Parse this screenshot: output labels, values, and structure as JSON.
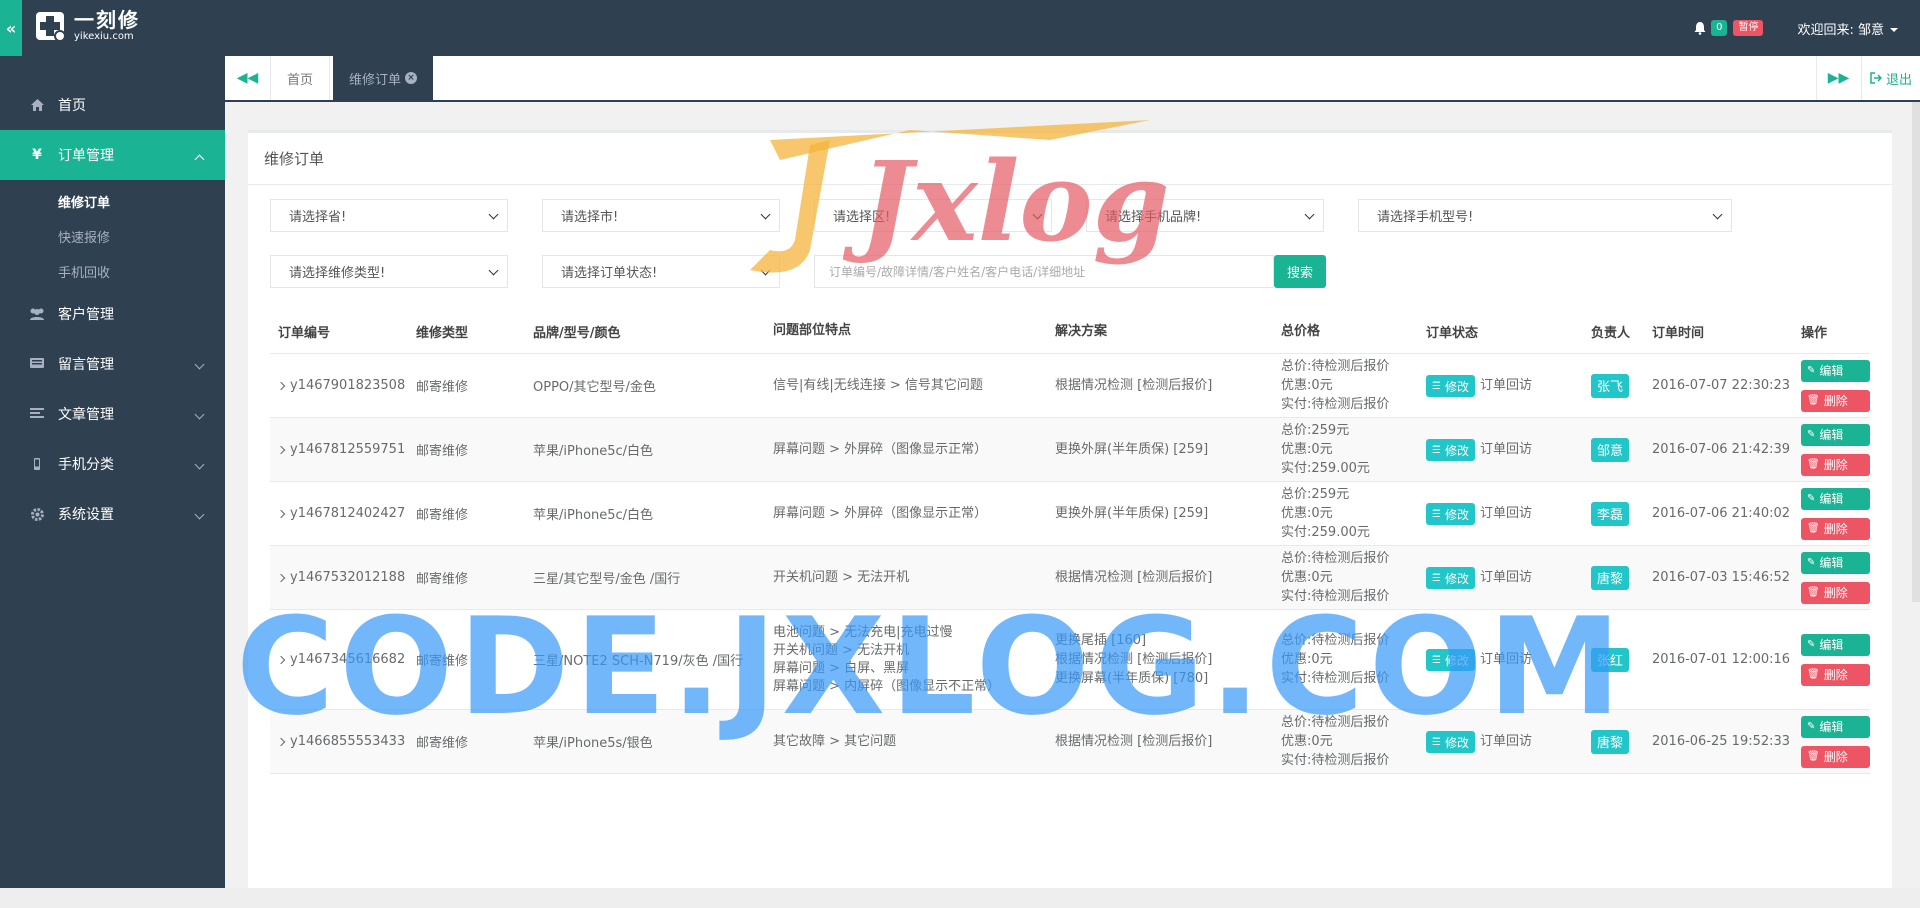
{
  "header": {
    "logo_cn": "一刻修",
    "logo_en": "yikexiu.com",
    "badge_count": "0",
    "badge_status": "暂停",
    "welcome": "欢迎回来: 邹意"
  },
  "sidebar": {
    "items": [
      {
        "label": "首页",
        "icon": "home-icon"
      },
      {
        "label": "订单管理",
        "icon": "yen-icon"
      },
      {
        "label": "客户管理",
        "icon": "users-icon"
      },
      {
        "label": "留言管理",
        "icon": "message-icon"
      },
      {
        "label": "文章管理",
        "icon": "list-icon"
      },
      {
        "label": "手机分类",
        "icon": "mobile-icon"
      },
      {
        "label": "系统设置",
        "icon": "gear-icon"
      }
    ],
    "sub_items": [
      "维修订单",
      "快速报修",
      "手机回收"
    ]
  },
  "tabs": {
    "home": "首页",
    "current": "维修订单",
    "logout": "退出"
  },
  "panel": {
    "title": "维修订单"
  },
  "filters": {
    "province": "请选择省!",
    "city": "请选择市!",
    "district": "请选择区!",
    "brand": "请选择手机品牌!",
    "model": "请选择手机型号!",
    "repair_type": "请选择维修类型!",
    "order_status": "请选择订单状态!",
    "search_placeholder": "订单编号/故障详情/客户姓名/客户电话/详细地址",
    "search_button": "搜索"
  },
  "table": {
    "headers": [
      "订单编号",
      "维修类型",
      "品牌/型号/颜色",
      "问题部位特点",
      "解决方案",
      "总价格",
      "订单状态",
      "负责人",
      "订单时间",
      "操作"
    ],
    "labels": {
      "modify": "修改",
      "visit": "订单回访",
      "edit": "编辑",
      "delete": "删除",
      "total": "总价:",
      "discount": "优惠:",
      "paid": "实付:"
    },
    "rows": [
      {
        "id": "y1467901823508",
        "type": "邮寄维修",
        "device": "OPPO/其它型号/金色",
        "issues": [
          "信号|有线|无线连接 > 信号其它问题"
        ],
        "solutions": [
          "根据情况检测 [检测后报价]"
        ],
        "total": "待检测后报价",
        "discount": "0元",
        "paid": "待检测后报价",
        "person": "张飞",
        "time": "2016-07-07 22:30:23"
      },
      {
        "id": "y1467812559751",
        "type": "邮寄维修",
        "device": "苹果/iPhone5c/白色",
        "issues": [
          "屏幕问题 > 外屏碎（图像显示正常）"
        ],
        "solutions": [
          "更换外屏(半年质保) [259]"
        ],
        "total": "259元",
        "discount": "0元",
        "paid": "259.00元",
        "person": "邹意",
        "time": "2016-07-06 21:42:39"
      },
      {
        "id": "y1467812402427",
        "type": "邮寄维修",
        "device": "苹果/iPhone5c/白色",
        "issues": [
          "屏幕问题 > 外屏碎（图像显示正常）"
        ],
        "solutions": [
          "更换外屏(半年质保) [259]"
        ],
        "total": "259元",
        "discount": "0元",
        "paid": "259.00元",
        "person": "李磊",
        "time": "2016-07-06 21:40:02"
      },
      {
        "id": "y1467532012188",
        "type": "邮寄维修",
        "device": "三星/其它型号/金色 /国行",
        "issues": [
          "开关机问题 > 无法开机"
        ],
        "solutions": [
          "根据情况检测 [检测后报价]"
        ],
        "total": "待检测后报价",
        "discount": "0元",
        "paid": "待检测后报价",
        "person": "唐黎",
        "time": "2016-07-03 15:46:52"
      },
      {
        "id": "y1467345616682",
        "type": "邮寄维修",
        "device": "三星/NOTE2 SCH-N719/灰色 /国行",
        "issues": [
          "电池问题 > 无法充电|充电过慢",
          "开关机问题 > 无法开机",
          "屏幕问题 > 白屏、黑屏",
          "屏幕问题 > 内屏碎（图像显示不正常）"
        ],
        "solutions": [
          "更换尾插 [160]",
          "根据情况检测 [检测后报价]",
          "更换屏幕(半年质保) [780]"
        ],
        "total": "待检测后报价",
        "discount": "0元",
        "paid": "待检测后报价",
        "person": "张红",
        "time": "2016-07-01 12:00:16"
      },
      {
        "id": "y1466855553433",
        "type": "邮寄维修",
        "device": "苹果/iPhone5s/银色",
        "issues": [
          "其它故障 > 其它问题"
        ],
        "solutions": [
          "根据情况检测 [检测后报价]"
        ],
        "total": "待检测后报价",
        "discount": "0元",
        "paid": "待检测后报价",
        "person": "唐黎",
        "time": "2016-06-25 19:52:33"
      }
    ]
  },
  "watermarks": {
    "logo": "Jxlog",
    "text": "CODE.JXLOG.COM"
  },
  "colors": {
    "sidebar": "#2f4050",
    "accent": "#1ab394",
    "info": "#23c6c8",
    "danger": "#ed5565"
  }
}
